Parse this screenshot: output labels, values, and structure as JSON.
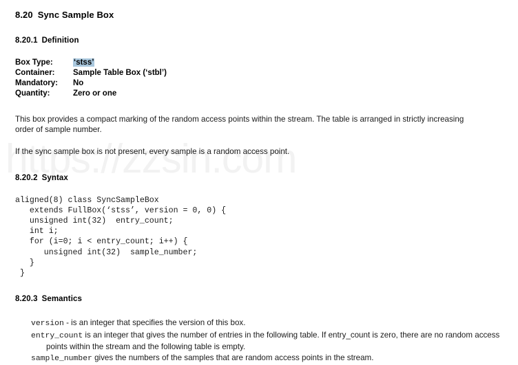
{
  "watermark": {
    "text": "https://zzsin.com",
    "color": "#f2f2f2"
  },
  "section": {
    "number": "8.20",
    "title": "Sync Sample Box"
  },
  "definition": {
    "heading_number": "8.20.1",
    "heading_title": "Definition",
    "rows": [
      {
        "key": "Box Type:",
        "value": "‘stss’",
        "highlight": true,
        "highlight_color": "#a9c7dd"
      },
      {
        "key": "Container:",
        "value": "Sample Table Box (‘stbl’)",
        "highlight": false
      },
      {
        "key": "Mandatory:",
        "value": "No",
        "highlight": false
      },
      {
        "key": "Quantity:",
        "value": "Zero or one",
        "highlight": false
      }
    ],
    "paragraph_1": "This box provides a compact marking of the random access points within the stream. The table is arranged in strictly increasing order of sample number.",
    "paragraph_2": "If the sync sample box is not present, every sample is a random access point."
  },
  "syntax": {
    "heading_number": "8.20.2",
    "heading_title": "Syntax",
    "code": "aligned(8) class SyncSampleBox\n   extends FullBox(‘stss’, version = 0, 0) {\n   unsigned int(32)  entry_count;\n   int i;\n   for (i=0; i < entry_count; i++) {\n      unsigned int(32)  sample_number;\n   }\n }"
  },
  "semantics": {
    "heading_number": "8.20.3",
    "heading_title": "Semantics",
    "items": [
      {
        "term": "version",
        "description": " - is an integer that specifies the version of this box."
      },
      {
        "term": "entry_count",
        "description": "  is an integer that gives the number of entries in the following table. If entry_count is zero, there are no random access points within the stream and the following table is empty."
      },
      {
        "term": "sample_number",
        "description": " gives the numbers of the samples that are random access points in the stream."
      }
    ]
  }
}
